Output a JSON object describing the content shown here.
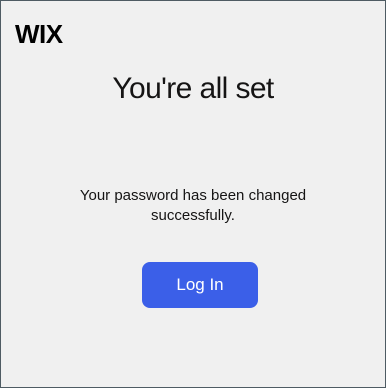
{
  "brand": {
    "logo_text": "WIX"
  },
  "content": {
    "title": "You're all set",
    "message": "Your password has been changed successfully."
  },
  "actions": {
    "login_label": "Log In"
  },
  "colors": {
    "accent": "#3b5fe8",
    "background": "#f0f0f0",
    "text": "#151414"
  }
}
